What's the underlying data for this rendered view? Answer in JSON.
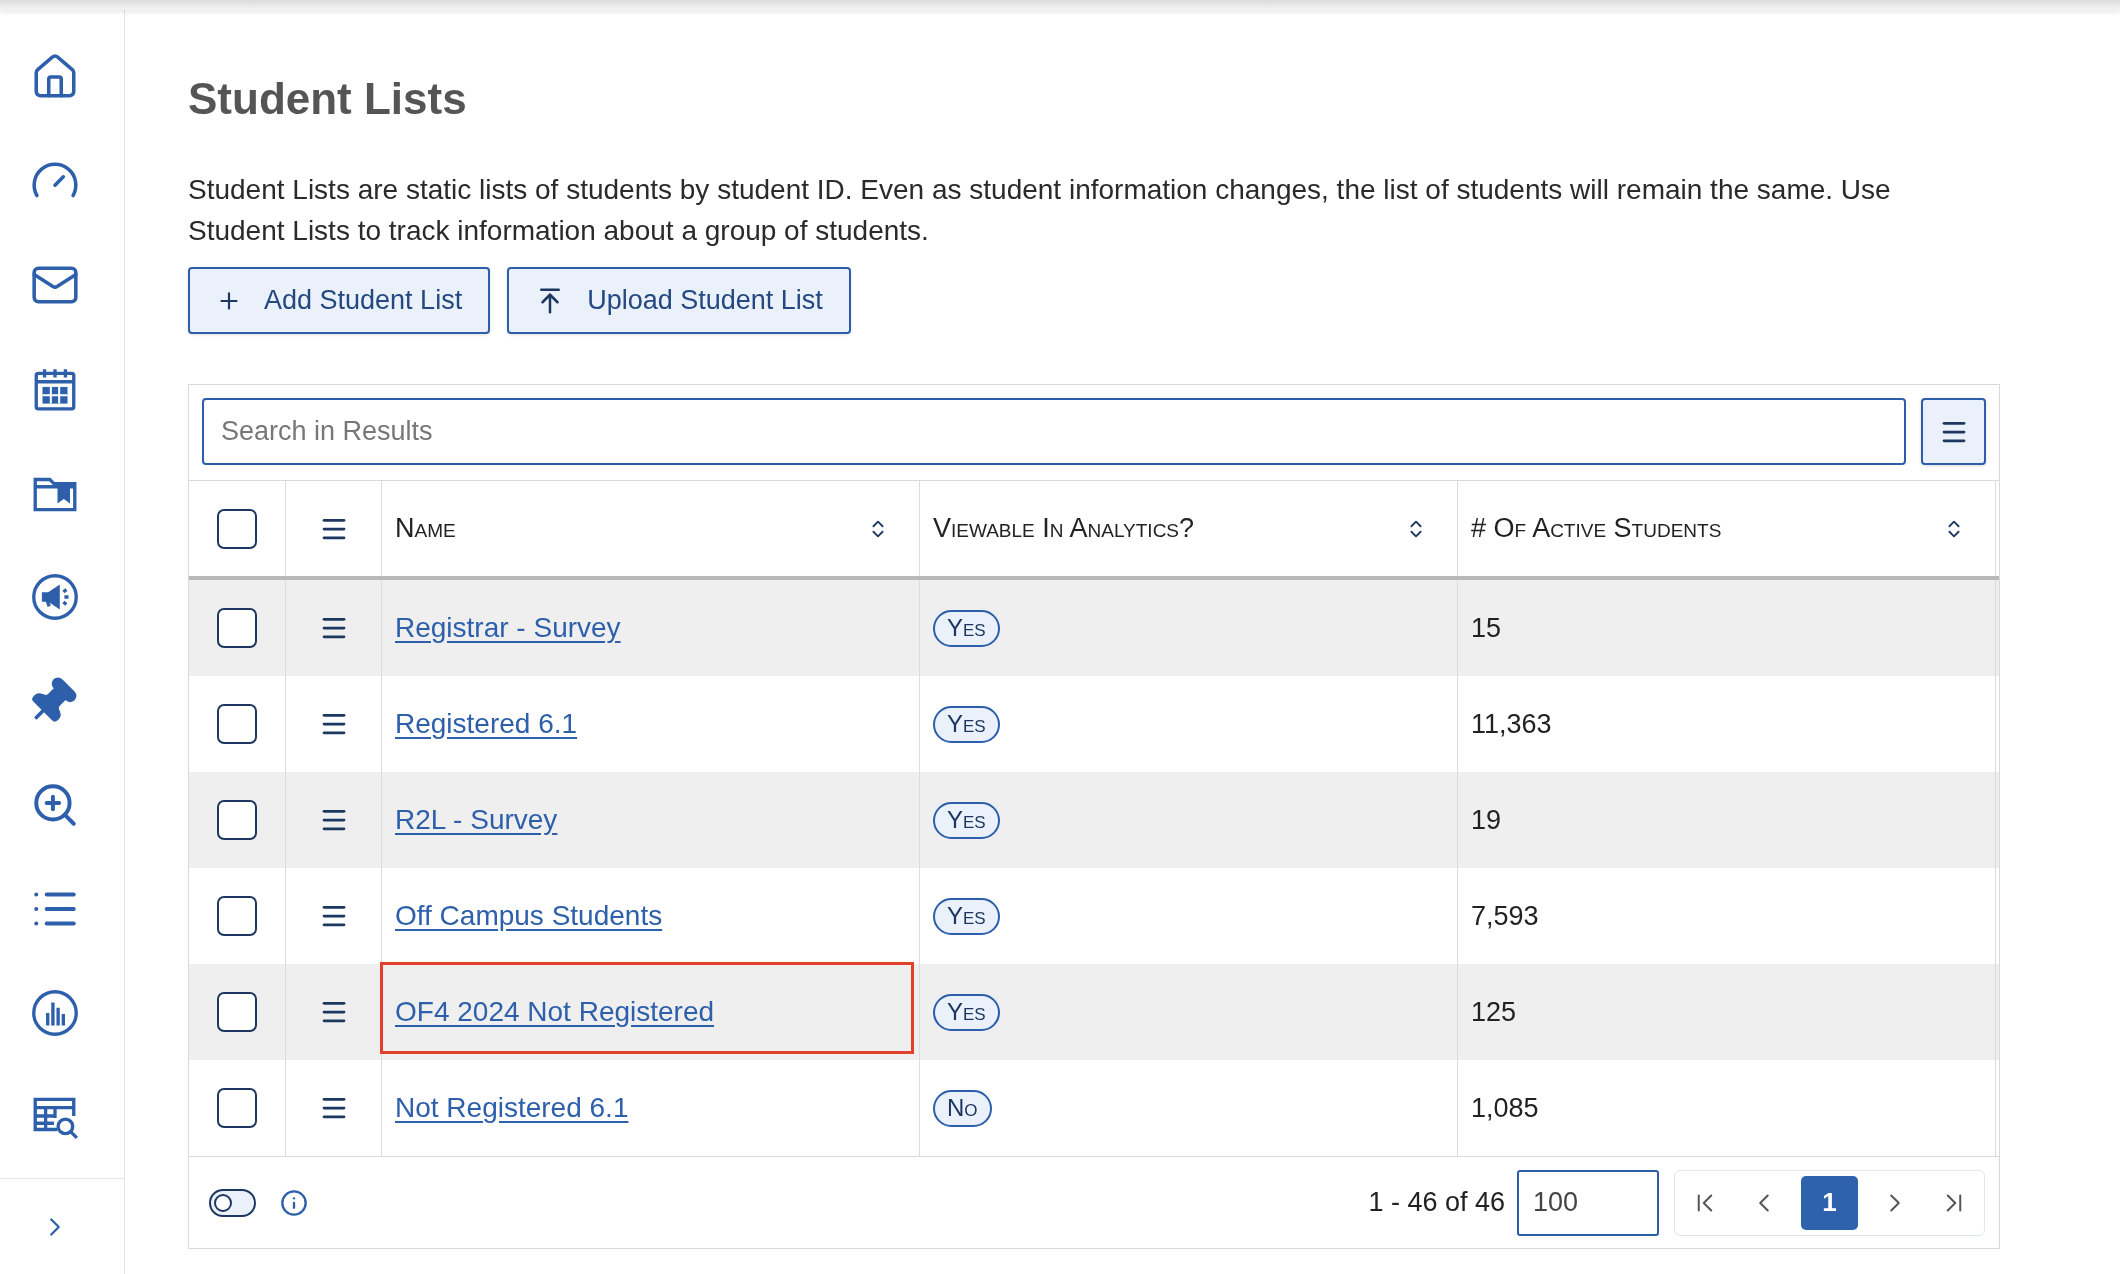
{
  "page": {
    "title": "Student Lists",
    "description": "Student Lists are static lists of students by student ID. Even as student information changes, the list of students will remain the same. Use Student Lists to track information about a group of students."
  },
  "actions": [
    {
      "kind": "add",
      "label": "Add Student List"
    },
    {
      "kind": "upload",
      "label": "Upload Student List"
    }
  ],
  "table": {
    "search": {
      "placeholder": "Search in Results"
    },
    "select_all": {
      "checked": false
    },
    "columns": [
      {
        "label": "Name"
      },
      {
        "label": "Viewable In Analytics?"
      },
      {
        "label": "# Of Active Students"
      }
    ],
    "rows": [
      {
        "name": "Registrar - Survey",
        "viewable": "Yes",
        "active_students": "15",
        "checked": false,
        "highlighted": false
      },
      {
        "name": "Registered 6.1",
        "viewable": "Yes",
        "active_students": "11,363",
        "checked": false,
        "highlighted": false
      },
      {
        "name": "R2L - Survey",
        "viewable": "Yes",
        "active_students": "19",
        "checked": false,
        "highlighted": false
      },
      {
        "name": "Off Campus Students",
        "viewable": "Yes",
        "active_students": "7,593",
        "checked": false,
        "highlighted": false
      },
      {
        "name": "OF4 2024 Not Registered",
        "viewable": "Yes",
        "active_students": "125",
        "checked": false,
        "highlighted": true
      },
      {
        "name": "Not Registered 6.1",
        "viewable": "No",
        "active_students": "1,085",
        "checked": false,
        "highlighted": false
      }
    ]
  },
  "footer": {
    "toggle": {
      "on": false
    },
    "range": "1 - 46 of 46",
    "page_size": "100",
    "pages": [
      {
        "label": "1",
        "selected": true
      }
    ]
  }
}
